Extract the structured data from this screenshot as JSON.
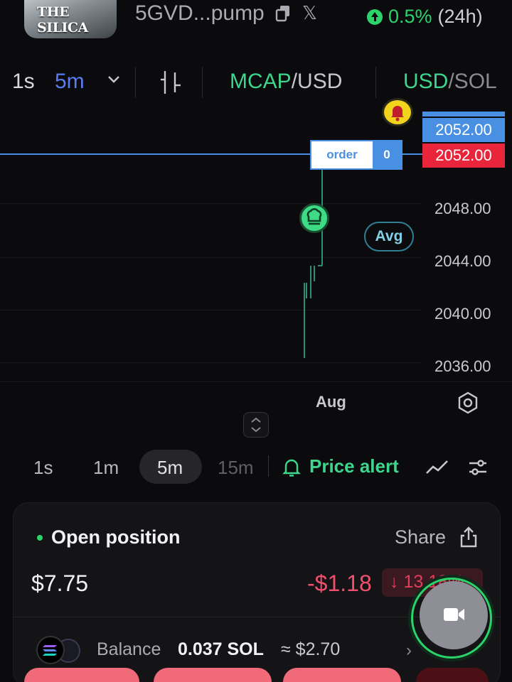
{
  "header": {
    "token_logo_text": "THE SILICA",
    "token_name": "5GVD...pump",
    "change_pct": "0.5%",
    "change_period": "(24h)"
  },
  "toolbar": {
    "interval_1s": "1s",
    "interval_5m": "5m",
    "mcap": "MCAP",
    "mcap_slash": "/USD",
    "usd": "USD",
    "usd_slash": "/SOL"
  },
  "chart": {
    "price_tag_blue": "2052.00",
    "price_tag_red": "2052.00",
    "y_labels": [
      "2048.00",
      "2044.00",
      "2040.00",
      "2036.00"
    ],
    "order_label": "order",
    "order_count": "0",
    "avg_label": "Avg",
    "x_label": "Aug"
  },
  "intervals": {
    "i1s": "1s",
    "i1m": "1m",
    "i5m": "5m",
    "i15m": "15m",
    "price_alert": "Price alert"
  },
  "position": {
    "title": "Open position",
    "share": "Share",
    "value": "$7.75",
    "pnl": "-$1.18",
    "pnl_pct": "↓ 13.18%",
    "balance_label": "Balance",
    "balance_sol": "0.037 SOL",
    "balance_usd": "≈ $2.70"
  },
  "colors": {
    "accent_green": "#3dd68c",
    "accent_blue": "#4a90e2",
    "accent_red": "#e8253a",
    "selected_interval": "#5a7cf2"
  }
}
